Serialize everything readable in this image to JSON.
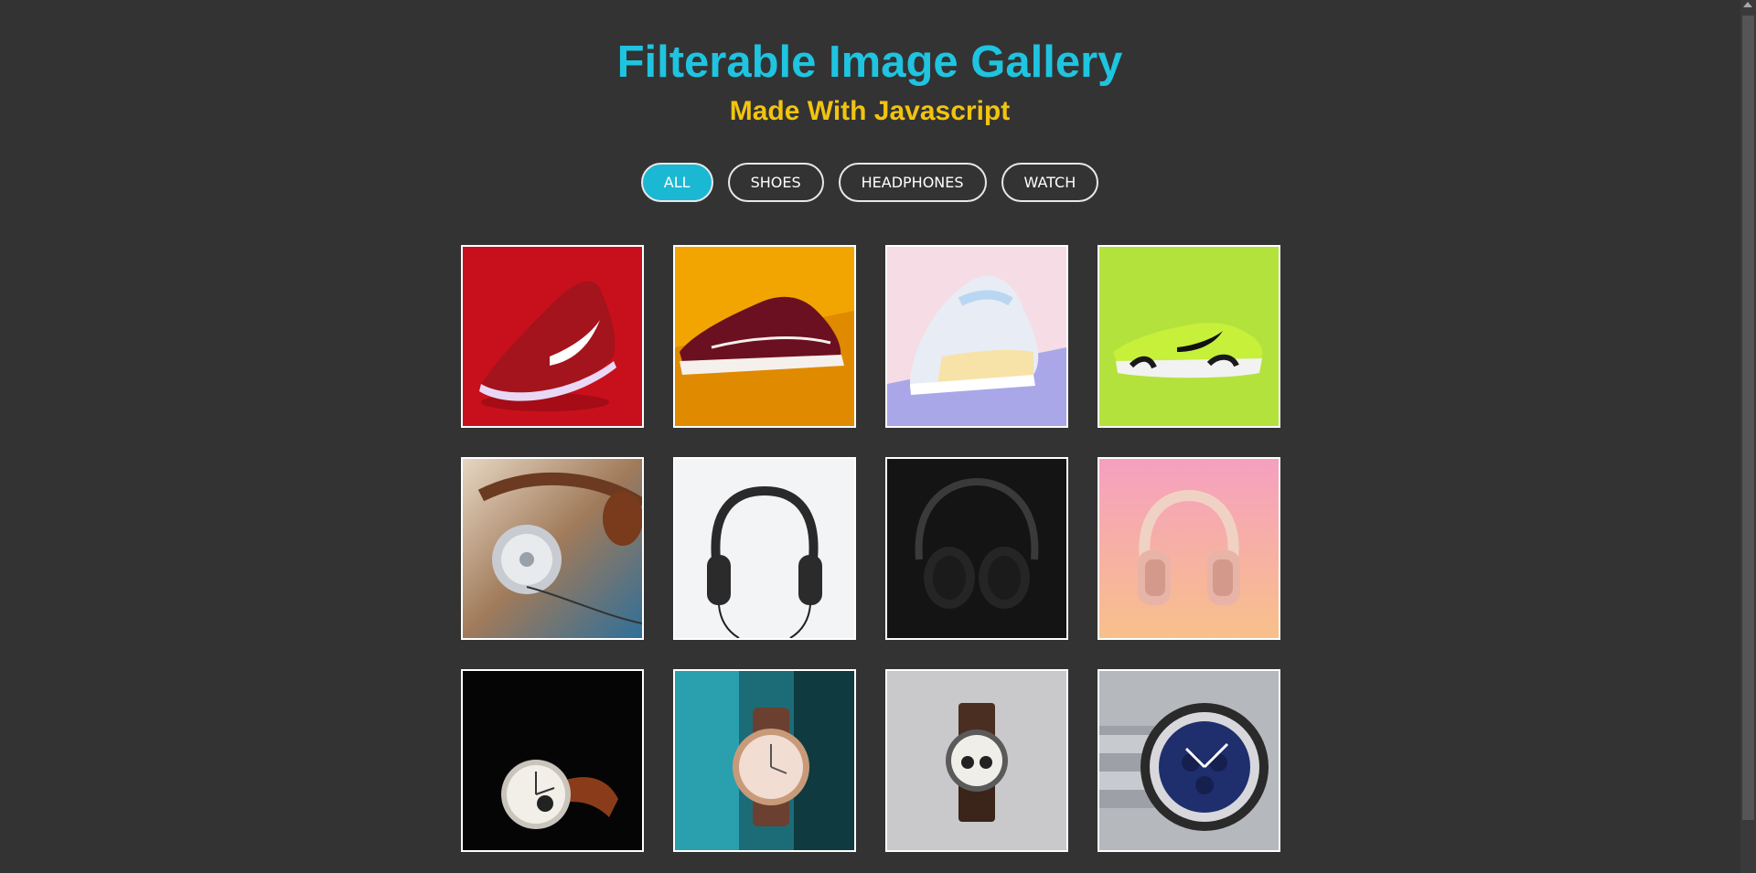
{
  "header": {
    "title": "Filterable Image Gallery",
    "subtitle": "Made With Javascript"
  },
  "filters": [
    {
      "label": "ALL",
      "active": true
    },
    {
      "label": "SHOES",
      "active": false
    },
    {
      "label": "HEADPHONES",
      "active": false
    },
    {
      "label": "WATCH",
      "active": false
    }
  ],
  "gallery": [
    {
      "category": "shoes",
      "icon": "red-sneaker-image",
      "bg": "#c8101c"
    },
    {
      "category": "shoes",
      "icon": "maroon-skate-shoe-image",
      "bg": "#f2a500"
    },
    {
      "category": "shoes",
      "icon": "pastel-sneaker-image",
      "bg": "#f6dce4"
    },
    {
      "category": "shoes",
      "icon": "lime-sneaker-image",
      "bg": "#b3e23c"
    },
    {
      "category": "headphones",
      "icon": "brown-headphones-image",
      "bg": "#b08866"
    },
    {
      "category": "headphones",
      "icon": "black-headphones-white-bg-image",
      "bg": "#f3f4f6"
    },
    {
      "category": "headphones",
      "icon": "black-headphones-dark-bg-image",
      "bg": "#141414"
    },
    {
      "category": "headphones",
      "icon": "pink-headphones-image",
      "bg": "#f7a5bd"
    },
    {
      "category": "watch",
      "icon": "white-dial-watch-dark-image",
      "bg": "#050505"
    },
    {
      "category": "watch",
      "icon": "rose-gold-watch-teal-image",
      "bg": "#1c6c78"
    },
    {
      "category": "watch",
      "icon": "chronograph-watch-grey-image",
      "bg": "#c9c9cc"
    },
    {
      "category": "watch",
      "icon": "blue-dial-steel-watch-image",
      "bg": "#b5b8bd"
    }
  ]
}
